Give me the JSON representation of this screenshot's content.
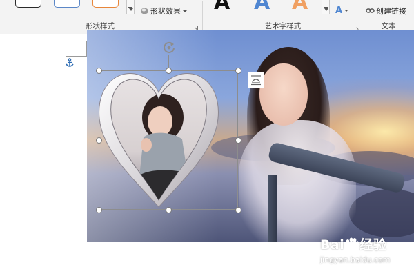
{
  "ribbon": {
    "shape_styles": {
      "label": "形状样式",
      "effects_label": "形状效果",
      "swatch_colors": [
        "#2b2b2b",
        "#5b87c7",
        "#e8863a"
      ]
    },
    "wordart_styles": {
      "label": "艺术字样式",
      "sample_letter": "A",
      "letter_colors": [
        "#111111",
        "#4f86d1",
        "#f0a062"
      ]
    },
    "text": {
      "label": "文本",
      "create_link_label": "创建链接"
    }
  },
  "watermark": {
    "brand_part1": "Bai",
    "brand_part2": "经验",
    "url": "jingyan.baidu.com"
  },
  "colors": {
    "anchor": "#2f6db3",
    "ribbon_bg": "#f3f3f3"
  }
}
